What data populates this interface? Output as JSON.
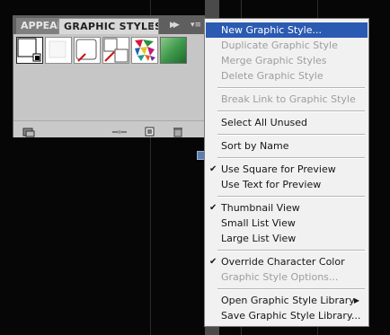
{
  "panel": {
    "tabs": [
      {
        "label": "APPEARANCE",
        "active": false
      },
      {
        "label": "GRAPHIC STYLES",
        "active": true
      }
    ],
    "collapse_icon": "double-chevron-right-icon",
    "menu_icon": "panel-menu-icon",
    "swatches": [
      {
        "name": "default-graphic-style"
      },
      {
        "name": "blank-style"
      },
      {
        "name": "none-style"
      },
      {
        "name": "split-style"
      },
      {
        "name": "mosaic-style"
      },
      {
        "name": "green-gradient-style"
      }
    ],
    "bottom_icons": [
      "graphic-style-libraries-icon",
      "break-link-icon",
      "new-graphic-style-icon",
      "trash-icon"
    ]
  },
  "menu": {
    "items": [
      {
        "label": "New Graphic Style...",
        "state": "highlighted"
      },
      {
        "label": "Duplicate Graphic Style",
        "state": "disabled"
      },
      {
        "label": "Merge Graphic Styles",
        "state": "disabled"
      },
      {
        "label": "Delete Graphic Style",
        "state": "disabled"
      },
      {
        "label": "Break Link to Graphic Style",
        "state": "disabled"
      },
      {
        "label": "Select All Unused",
        "state": "enabled"
      },
      {
        "label": "Sort by Name",
        "state": "enabled"
      },
      {
        "label": "Use Square for Preview",
        "state": "enabled",
        "checked": true
      },
      {
        "label": "Use Text for Preview",
        "state": "enabled"
      },
      {
        "label": "Thumbnail View",
        "state": "enabled",
        "checked": true
      },
      {
        "label": "Small List View",
        "state": "enabled"
      },
      {
        "label": "Large List View",
        "state": "enabled"
      },
      {
        "label": "Override Character Color",
        "state": "enabled",
        "checked": true
      },
      {
        "label": "Graphic Style Options...",
        "state": "disabled"
      },
      {
        "label": "Open Graphic Style Library",
        "state": "enabled",
        "submenu": true
      },
      {
        "label": "Save Graphic Style Library...",
        "state": "enabled"
      }
    ],
    "checkmark": "✔",
    "submenu_arrow": "▶"
  },
  "colors": {
    "highlight": "#2b5ab2",
    "disabled_text": "#9d9d9d",
    "menu_background": "#f1f1f1",
    "panel_background": "#c9c9c9"
  }
}
